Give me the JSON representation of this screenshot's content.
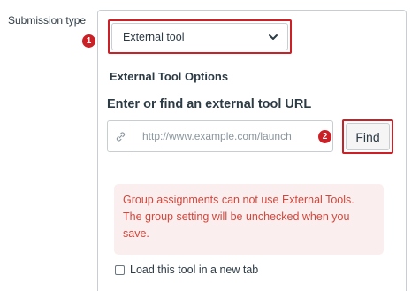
{
  "form": {
    "submission_type_label": "Submission type",
    "submission_type_value": "External tool",
    "external_tool_options_heading": "External Tool Options",
    "url_heading": "Enter or find an external tool URL",
    "url_placeholder": "http://www.example.com/launch",
    "url_value": "",
    "find_label": "Find",
    "alert_text": "Group assignments can not use External Tools. The group setting will be unchecked when you save.",
    "new_tab_label": "Load this tool in a new tab"
  },
  "annotations": {
    "marker_1": "1",
    "marker_2": "2"
  },
  "icons": {
    "select_chevron": "chevron-down-icon",
    "url_prefix": "link-icon"
  },
  "colors": {
    "highlight": "#cc2027",
    "alert_text": "#d2473c",
    "alert_bg": "#fbeeee"
  }
}
